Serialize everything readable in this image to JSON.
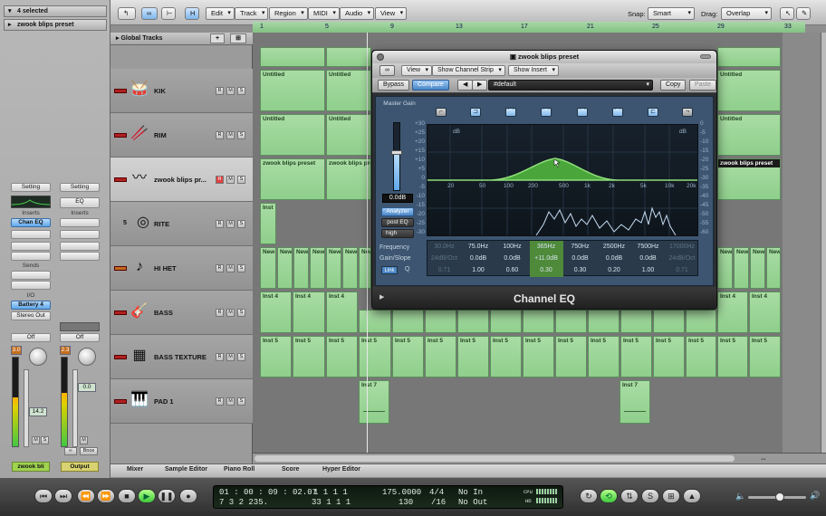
{
  "inspector": {
    "selection": "4 selected",
    "region_name": "zwook blips preset",
    "left_strip": {
      "setting": "Setting",
      "inserts_label": "Inserts",
      "insert_1": "Chan EQ",
      "sends_label": "Sends",
      "io_label": "I/O",
      "input": "Battery 4",
      "output": "Stereo Out",
      "automation": "Off",
      "peak": "3.0",
      "fader_value": "14.2",
      "m": "M",
      "s": "S",
      "name": "zwook bli",
      "level": 0.55
    },
    "right_strip": {
      "setting": "Setting",
      "eq": "EQ",
      "inserts_label": "Inserts",
      "automation": "Off",
      "peak": "2.3",
      "fader_value": "0.0",
      "m": "M",
      "bnce": "Bnce",
      "name": "Output",
      "level": 0.6
    }
  },
  "toolbar": {
    "buttons": [
      "Edit",
      "Track",
      "Region",
      "MIDI",
      "Audio",
      "View"
    ],
    "snap_label": "Snap:",
    "snap_value": "Smart",
    "drag_label": "Drag:",
    "drag_value": "Overlap"
  },
  "global_tracks": "Global Tracks",
  "ruler": [
    "1",
    "5",
    "9",
    "13",
    "17",
    "21",
    "25",
    "29",
    "33"
  ],
  "tracks": [
    {
      "num": "",
      "name": "KIK",
      "icon": "drum-icon"
    },
    {
      "num": "",
      "name": "RIM",
      "icon": "drumstick-icon"
    },
    {
      "num": "",
      "name": "zwook blips pr...",
      "icon": "synth-icon"
    },
    {
      "num": "5",
      "name": "RITE",
      "icon": "cymbal-icon"
    },
    {
      "num": "",
      "name": "HI HET",
      "icon": "hihat-icon"
    },
    {
      "num": "",
      "name": "BASS",
      "icon": "guitar-icon"
    },
    {
      "num": "",
      "name": "BASS TEXTURE",
      "icon": "amp-icon"
    },
    {
      "num": "",
      "name": "PAD 1",
      "icon": "keyboard-icon"
    }
  ],
  "regions": {
    "untitled": "Untitled",
    "zwook": "zwook blips preset",
    "inst": "Inst",
    "new": "New",
    "inst4": "Inst 4",
    "inst5": "Inst 5",
    "inst7": "Inst 7"
  },
  "eq": {
    "title": "zwook blips preset",
    "menu": [
      "View",
      "Show Channel Strip",
      "Show Insert"
    ],
    "bypass": "Bypass",
    "compare": "Compare",
    "preset": "#default",
    "copy": "Copy",
    "paste": "Paste",
    "master_gain_label": "Master Gain",
    "master_gain_value": "0.0dB",
    "analyzer": "Analyzer",
    "post_eq": "post EQ",
    "high": "high",
    "db_label": "dB",
    "left_scale": [
      "+30",
      "+25",
      "+20",
      "+15",
      "+10",
      "+5",
      "0",
      "-5",
      "-10",
      "-15",
      "-20",
      "-25",
      "-30"
    ],
    "right_scale": [
      "0",
      "-5",
      "-10",
      "-15",
      "-20",
      "-25",
      "-30",
      "-35",
      "-40",
      "-45",
      "-50",
      "-55",
      "-60"
    ],
    "freq_scale": [
      "20",
      "50",
      "100",
      "200",
      "500",
      "1k",
      "2k",
      "5k",
      "10k",
      "20k"
    ],
    "param_labels": [
      "Frequency",
      "Gain/Slope",
      "Q"
    ],
    "link": "Link",
    "bands": [
      {
        "freq": "30.0Hz",
        "gain": "24dB/Oct",
        "q": "0.71",
        "dim": true
      },
      {
        "freq": "75.0Hz",
        "gain": "0.0dB",
        "q": "1.00",
        "dim": false
      },
      {
        "freq": "100Hz",
        "gain": "0.0dB",
        "q": "0.60",
        "dim": false
      },
      {
        "freq": "365Hz",
        "gain": "+11.0dB",
        "q": "0.30",
        "dim": false,
        "active": true
      },
      {
        "freq": "750Hz",
        "gain": "0.0dB",
        "q": "0.30",
        "dim": false
      },
      {
        "freq": "2500Hz",
        "gain": "0.0dB",
        "q": "0.20",
        "dim": false
      },
      {
        "freq": "7500Hz",
        "gain": "0.0dB",
        "q": "1.00",
        "dim": false
      },
      {
        "freq": "17000Hz",
        "gain": "24dB/Oct",
        "q": "0.71",
        "dim": true
      }
    ],
    "name": "Channel EQ"
  },
  "tabs": [
    "Mixer",
    "Sample Editor",
    "Piano Roll",
    "Score",
    "Hyper Editor"
  ],
  "transport": {
    "smpte": "01 : 00 : 09 : 02.07",
    "bars_top": "1     1     1     1",
    "bars_bottom": "7     3     2   235.",
    "pos_bottom": "33     1     1     1",
    "tempo": "175.0000",
    "division": "130",
    "sig_top": "4/4",
    "sig_bottom": "/16",
    "in": "No In",
    "out": "No Out",
    "cpu": "CPU",
    "hd": "HD"
  },
  "colors": {
    "region": "#9fd69b",
    "eq_curve": "#4aa63a",
    "active_band": "#4e8a3a"
  }
}
